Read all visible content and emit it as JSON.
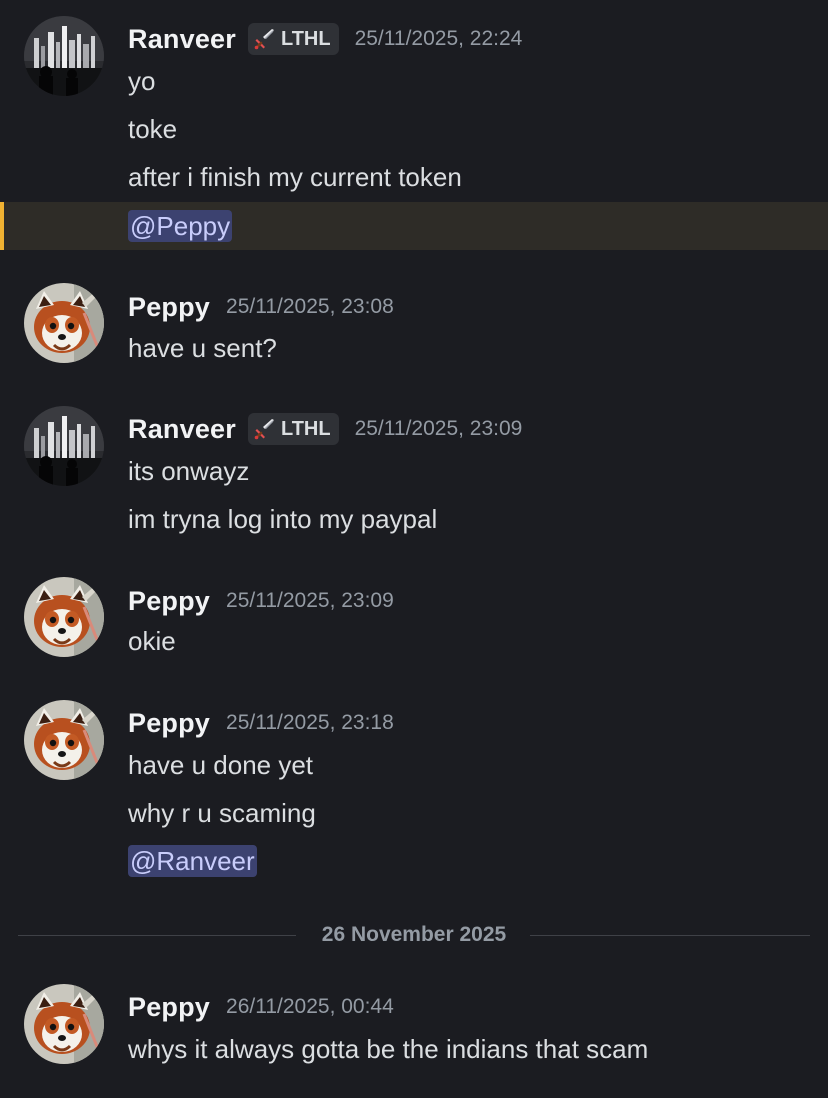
{
  "users": {
    "ranveer": {
      "name": "Ranveer",
      "tag": "LTHL",
      "tag_icon": "sword-icon",
      "avatar": "city-skyline-avatar"
    },
    "peppy": {
      "name": "Peppy",
      "avatar": "red-panda-avatar"
    }
  },
  "messages": [
    {
      "author": "Ranveer",
      "tag": "LTHL",
      "timestamp": "25/11/2025, 22:24",
      "lines": [
        "yo",
        "toke",
        "after i finish my current token",
        "@Peppy"
      ]
    },
    {
      "author": "Peppy",
      "timestamp": "25/11/2025, 23:08",
      "lines": [
        "have u sent?"
      ]
    },
    {
      "author": "Ranveer",
      "tag": "LTHL",
      "timestamp": "25/11/2025, 23:09",
      "lines": [
        "its onwayz",
        "im tryna log into my paypal"
      ]
    },
    {
      "author": "Peppy",
      "timestamp": "25/11/2025, 23:09",
      "lines": [
        "okie"
      ]
    },
    {
      "author": "Peppy",
      "timestamp": "25/11/2025, 23:18",
      "lines": [
        "have u done yet",
        "why r u scaming",
        "@Ranveer"
      ]
    },
    {
      "author": "Peppy",
      "timestamp": "26/11/2025, 00:44",
      "lines": [
        "whys it always gotta be the indians that scam"
      ]
    }
  ],
  "date_divider": "26 November 2025",
  "colors": {
    "background": "#1b1c21",
    "mention_background": "#3c4270",
    "mention_text": "#c9cdfb",
    "highlight_background": "#2e2c27",
    "highlight_bar": "#f0b232",
    "timestamp": "#949ba4"
  }
}
